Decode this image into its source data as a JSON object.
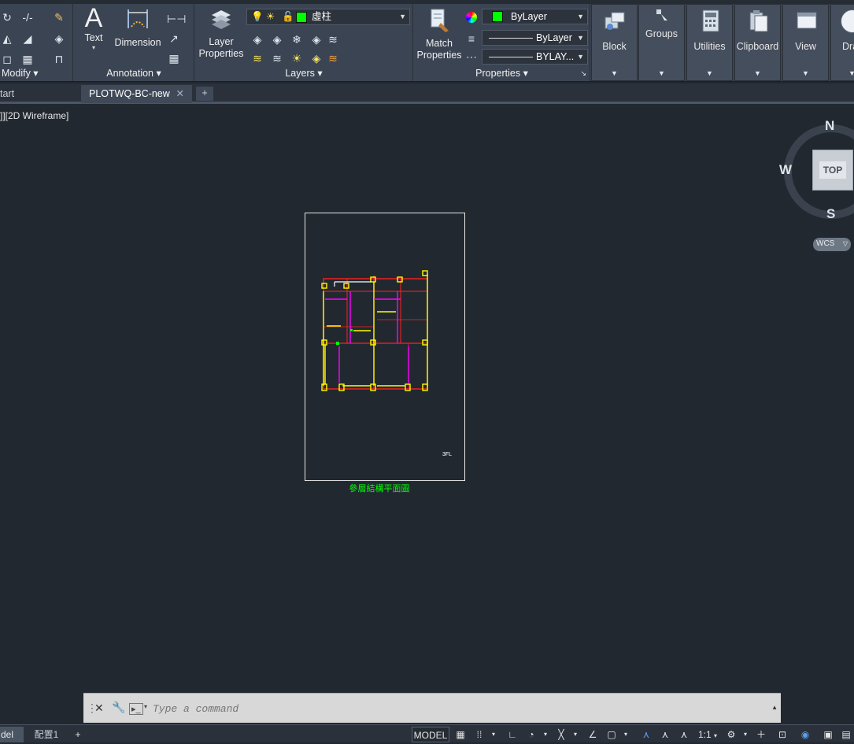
{
  "ribbon": {
    "panels": {
      "modify": {
        "title": "Modify"
      },
      "annotation": {
        "title": "Annotation",
        "text_label": "Text",
        "dimension_label": "Dimension"
      },
      "layers": {
        "title": "Layers",
        "layer_properties_line1": "Layer",
        "layer_properties_line2": "Properties",
        "current_layer": "虛柱"
      },
      "properties": {
        "title": "Properties",
        "match_line1": "Match",
        "match_line2": "Properties",
        "color": "ByLayer",
        "lineweight": "ByLayer",
        "linetype": "BYLAY..."
      },
      "block": {
        "label": "Block"
      },
      "groups": {
        "label": "Groups"
      },
      "utilities": {
        "label": "Utilities"
      },
      "clipboard": {
        "label": "Clipboard"
      },
      "view": {
        "label": "View"
      },
      "draw_cut": {
        "label": "Dra"
      }
    }
  },
  "file_tabs": {
    "start_label": "tart",
    "active_label": "PLOTWQ-BC-new",
    "add_label": "+"
  },
  "viewport": {
    "label": "]][2D Wireframe]",
    "drawing_title": "參層結構平面圖",
    "sheet_note": "3FL"
  },
  "viewcube": {
    "north": "N",
    "south": "S",
    "west": "W",
    "face": "TOP",
    "ucs": "WCS"
  },
  "command_line": {
    "placeholder": "Type a command"
  },
  "layout_tabs": {
    "model_label": "del",
    "layout1_label": "配置1",
    "add_label": "+"
  },
  "statusbar": {
    "model_label": "MODEL",
    "scale_label": "1:1"
  },
  "colors": {
    "ribbon_bg": "#3b4453",
    "canvas_bg": "#212830",
    "layer_swatch": "#00ff00",
    "title_text": "#00ff00"
  }
}
